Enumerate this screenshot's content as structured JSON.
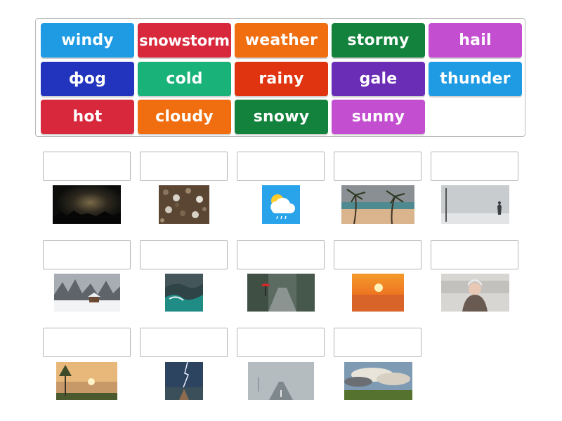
{
  "word_bank": {
    "tiles": [
      {
        "label": "windy",
        "color": "#1e9be3"
      },
      {
        "label": "snowstorm",
        "color": "#d8283c"
      },
      {
        "label": "weather",
        "color": "#f06e0f"
      },
      {
        "label": "stormy",
        "color": "#12823c"
      },
      {
        "label": "hail",
        "color": "#c34fd0"
      },
      {
        "label": "фog",
        "color": "#2233bd"
      },
      {
        "label": "cold",
        "color": "#19b37a"
      },
      {
        "label": "rainy",
        "color": "#e03410"
      },
      {
        "label": "gale",
        "color": "#6a2db6"
      },
      {
        "label": "thunder",
        "color": "#1e9be3"
      },
      {
        "label": "hot",
        "color": "#d8283c"
      },
      {
        "label": "cloudy",
        "color": "#f06e0f"
      },
      {
        "label": "snowy",
        "color": "#12823c"
      },
      {
        "label": "sunny",
        "color": "#c34fd0"
      }
    ]
  },
  "drop_targets": [
    {
      "image": "night-storm-clouds"
    },
    {
      "image": "hailstones-on-ground"
    },
    {
      "image": "weather-app-icon"
    },
    {
      "image": "windy-palm-beach"
    },
    {
      "image": "snowstorm-person-walking"
    },
    {
      "image": "snowy-cabin"
    },
    {
      "image": "gale-waves"
    },
    {
      "image": "rainy-street-red-umbrella"
    },
    {
      "image": "sunny-desert"
    },
    {
      "image": "cold-woman-snow"
    },
    {
      "image": "sunset-lake-forest"
    },
    {
      "image": "thunder-lightning-road"
    },
    {
      "image": "foggy-road"
    },
    {
      "image": "cloudy-sky-field"
    }
  ]
}
